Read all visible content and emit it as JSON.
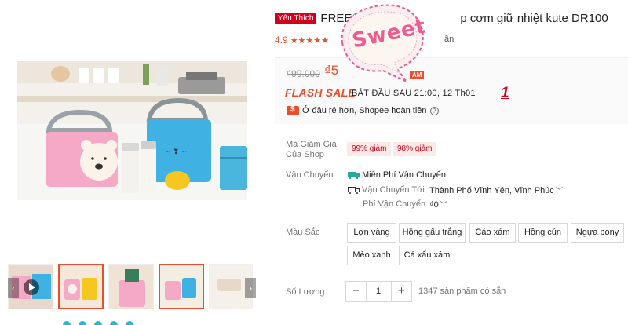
{
  "product": {
    "badge": "Yêu Thích",
    "title_start": "FREES",
    "title_end": "p cơm giữ nhiệt kute DR100",
    "rating": "4.9",
    "rating_tail": "ần"
  },
  "price": {
    "original": "₫99.000",
    "current": "₫5",
    "discount_tag": "ÁM",
    "flash_sale_label": "FLASH SALE",
    "flash_sale_time": "BẮT ĐẦU SAU 21:00, 12 Th01",
    "cheaper_text": "Ở đâu rẻ hơn, Shopee hoàn tiền",
    "annotation": "1"
  },
  "sticker": {
    "text": "Sweet"
  },
  "shop_voucher": {
    "label_line1": "Mã Giảm Giá",
    "label_line2": "Của Shop",
    "vouchers": [
      "99% giảm",
      "98% giảm"
    ]
  },
  "shipping": {
    "label": "Vận Chuyển",
    "free_ship": "Miễn Phí Vận Chuyển",
    "ship_to_label": "Vận Chuyển Tới",
    "ship_to_value": "Thành Phố Vĩnh Yên, Vĩnh Phúc",
    "fee_label": "Phí Vận Chuyển",
    "fee_value": "₫0"
  },
  "colors": {
    "label": "Màu Sắc",
    "options": [
      "Lợn vàng",
      "Hồng gấu trắng",
      "Cáo xám",
      "Hồng cún",
      "Ngựa pony",
      "Mèo xanh",
      "Cá xấu xám"
    ]
  },
  "quantity": {
    "label": "Số Lượng",
    "minus": "−",
    "value": "1",
    "plus": "+",
    "stock": "1347 sản phẩm có sẵn"
  },
  "theme": {
    "accent": "#ee4d2d",
    "badge_red": "#d0011b",
    "voucher_bg": "#fbe9e7"
  }
}
